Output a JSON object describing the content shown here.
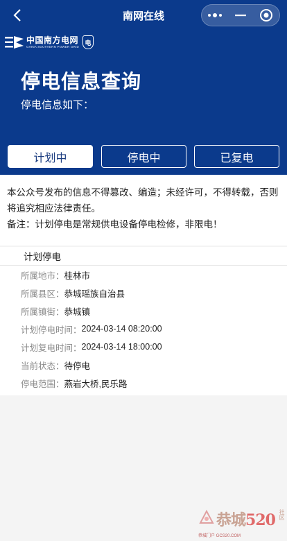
{
  "app": {
    "title": "南网在线"
  },
  "brand": {
    "name_cn": "中国南方电网",
    "name_en": "CHINA SOUTHERN POWER GRID",
    "badge_text": "电",
    "color": "#0b3a8c"
  },
  "header": {
    "title": "停电信息查询",
    "subtitle": "停电信息如下："
  },
  "tabs": [
    {
      "label": "计划中",
      "active": true
    },
    {
      "label": "停电中",
      "active": false
    },
    {
      "label": "已复电",
      "active": false
    }
  ],
  "notice": {
    "text": "本公众号发布的信息不得篡改、编造；未经许可，不得转载，否则将追究相应法律责任。",
    "remark": "备注：计划停电是常规供电设备停电检修，非限电！"
  },
  "detail": {
    "section_title": "计划停电",
    "rows": [
      {
        "key": "所属地市：",
        "value": "桂林市"
      },
      {
        "key": "所属县区：",
        "value": "恭城瑶族自治县"
      },
      {
        "key": "所属镇街：",
        "value": "恭城镇"
      },
      {
        "key": "计划停电时间：",
        "value": "2024-03-14 08:20:00"
      },
      {
        "key": "计划复电时间：",
        "value": "2024-03-14 18:00:00"
      },
      {
        "key": "当前状态：",
        "value": "待停电"
      },
      {
        "key": "停电范围：",
        "value": "燕岩大桥,民乐路"
      }
    ]
  },
  "watermark": {
    "main": "恭城",
    "num": "520",
    "side": "社区",
    "sub": "恭城门户 GCS20.COM"
  },
  "icons": [
    "back-arrow-icon",
    "more-dots-icon",
    "minimize-icon",
    "close-target-icon",
    "csg-logo-icon"
  ]
}
